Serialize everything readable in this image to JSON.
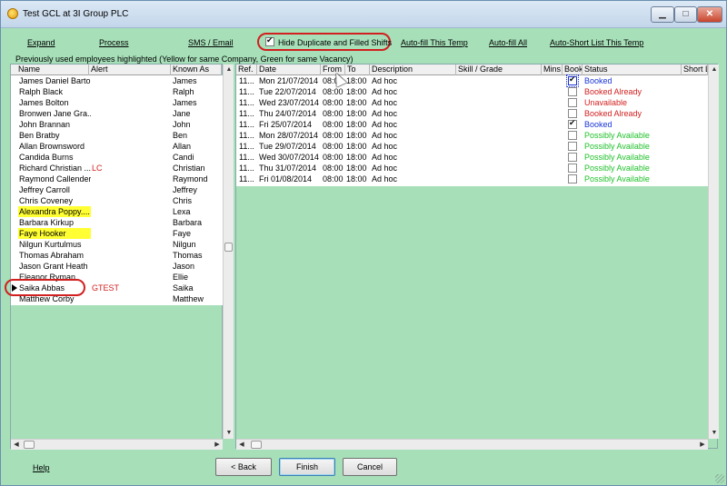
{
  "window": {
    "title": "Test GCL at 3I Group PLC",
    "minimize": "▁",
    "maximize": "□",
    "close": "✕"
  },
  "toolbar": {
    "expand": "Expand",
    "process": "Process",
    "sms_email": "SMS / Email",
    "hide_duplicates": "Hide Duplicate and Filled Shifts",
    "hide_duplicates_checked": true,
    "auto_fill_temp": "Auto-fill This Temp",
    "auto_fill_all": "Auto-fill All",
    "auto_short_list": "Auto-Short List This Temp"
  },
  "hint": "Previously used employees highlighted (Yellow for same Company, Green for same Vacancy)",
  "employees": {
    "columns": [
      "Name",
      "Alert",
      "Known As"
    ],
    "rows": [
      {
        "name": "James Daniel Barton",
        "alert": "",
        "known_as": "James",
        "highlight": ""
      },
      {
        "name": "Ralph Black",
        "alert": "",
        "known_as": "Ralph",
        "highlight": ""
      },
      {
        "name": "James Bolton",
        "alert": "",
        "known_as": "James",
        "highlight": ""
      },
      {
        "name": "Bronwen Jane Gra...",
        "alert": "",
        "known_as": "Jane",
        "highlight": ""
      },
      {
        "name": "John Brannan",
        "alert": "",
        "known_as": "John",
        "highlight": ""
      },
      {
        "name": "Ben Bratby",
        "alert": "",
        "known_as": "Ben",
        "highlight": ""
      },
      {
        "name": "Allan Brownsword",
        "alert": "",
        "known_as": "Allan",
        "highlight": ""
      },
      {
        "name": "Candida Burns",
        "alert": "",
        "known_as": "Candi",
        "highlight": ""
      },
      {
        "name": "Richard Christian ...",
        "alert": "LC",
        "known_as": "Christian",
        "highlight": ""
      },
      {
        "name": "Raymond Callender",
        "alert": "",
        "known_as": "Raymond",
        "highlight": ""
      },
      {
        "name": "Jeffrey Carroll",
        "alert": "",
        "known_as": "Jeffrey",
        "highlight": ""
      },
      {
        "name": "Chris Coveney",
        "alert": "",
        "known_as": "Chris",
        "highlight": ""
      },
      {
        "name": "Alexandra Poppy....",
        "alert": "",
        "known_as": "Lexa",
        "highlight": "yellow"
      },
      {
        "name": "Barbara Kirkup",
        "alert": "",
        "known_as": "Barbara",
        "highlight": ""
      },
      {
        "name": "Faye Hooker",
        "alert": "",
        "known_as": "Faye",
        "highlight": "yellow"
      },
      {
        "name": "Nilgun Kurtulmus",
        "alert": "",
        "known_as": "Nilgun",
        "highlight": ""
      },
      {
        "name": "Thomas Abraham",
        "alert": "",
        "known_as": "Thomas",
        "highlight": ""
      },
      {
        "name": "Jason Grant Heath",
        "alert": "",
        "known_as": "Jason",
        "highlight": ""
      },
      {
        "name": "Eleanor Ryman",
        "alert": "",
        "known_as": "Ellie",
        "highlight": ""
      },
      {
        "name": "Saika Abbas",
        "alert": "GTEST",
        "known_as": "Saika",
        "highlight": "",
        "current": true
      },
      {
        "name": "Matthew Corby",
        "alert": "",
        "known_as": "Matthew",
        "highlight": ""
      }
    ]
  },
  "shifts": {
    "columns": [
      "Ref.",
      "Date",
      "From",
      "To",
      "Description",
      "Skill / Grade",
      "Mins",
      "Book",
      "Status",
      "Short L"
    ],
    "rows": [
      {
        "ref": "11...",
        "date": "Mon 21/07/2014",
        "from": "08:00",
        "to": "18:00",
        "description": "Ad hoc",
        "book": true,
        "status": "Booked",
        "status_color": "blue"
      },
      {
        "ref": "11...",
        "date": "Tue 22/07/2014",
        "from": "08:00",
        "to": "18:00",
        "description": "Ad hoc",
        "book": false,
        "status": "Booked Already",
        "status_color": "red"
      },
      {
        "ref": "11...",
        "date": "Wed 23/07/2014",
        "from": "08:00",
        "to": "18:00",
        "description": "Ad hoc",
        "book": false,
        "status": "Unavailable",
        "status_color": "red"
      },
      {
        "ref": "11...",
        "date": "Thu 24/07/2014",
        "from": "08:00",
        "to": "18:00",
        "description": "Ad hoc",
        "book": false,
        "status": "Booked Already",
        "status_color": "red"
      },
      {
        "ref": "11...",
        "date": "Fri 25/07/2014",
        "from": "08:00",
        "to": "18:00",
        "description": "Ad hoc",
        "book": true,
        "status": "Booked",
        "status_color": "blue"
      },
      {
        "ref": "11...",
        "date": "Mon 28/07/2014",
        "from": "08:00",
        "to": "18:00",
        "description": "Ad hoc",
        "book": false,
        "status": "Possibly Available",
        "status_color": "green"
      },
      {
        "ref": "11...",
        "date": "Tue 29/07/2014",
        "from": "08:00",
        "to": "18:00",
        "description": "Ad hoc",
        "book": false,
        "status": "Possibly Available",
        "status_color": "green"
      },
      {
        "ref": "11...",
        "date": "Wed 30/07/2014",
        "from": "08:00",
        "to": "18:00",
        "description": "Ad hoc",
        "book": false,
        "status": "Possibly Available",
        "status_color": "green"
      },
      {
        "ref": "11...",
        "date": "Thu 31/07/2014",
        "from": "08:00",
        "to": "18:00",
        "description": "Ad hoc",
        "book": false,
        "status": "Possibly Available",
        "status_color": "green"
      },
      {
        "ref": "11...",
        "date": "Fri 01/08/2014",
        "from": "08:00",
        "to": "18:00",
        "description": "Ad hoc",
        "book": false,
        "status": "Possibly Available",
        "status_color": "green"
      }
    ]
  },
  "footer": {
    "help": "Help",
    "back": "< Back",
    "finish": "Finish",
    "cancel": "Cancel"
  },
  "colors": {
    "background": "#a6dfb8",
    "highlight_yellow": "#ffff33",
    "status_blue": "#1a35d6",
    "status_red": "#d21f1f",
    "status_green": "#1fc02a"
  }
}
